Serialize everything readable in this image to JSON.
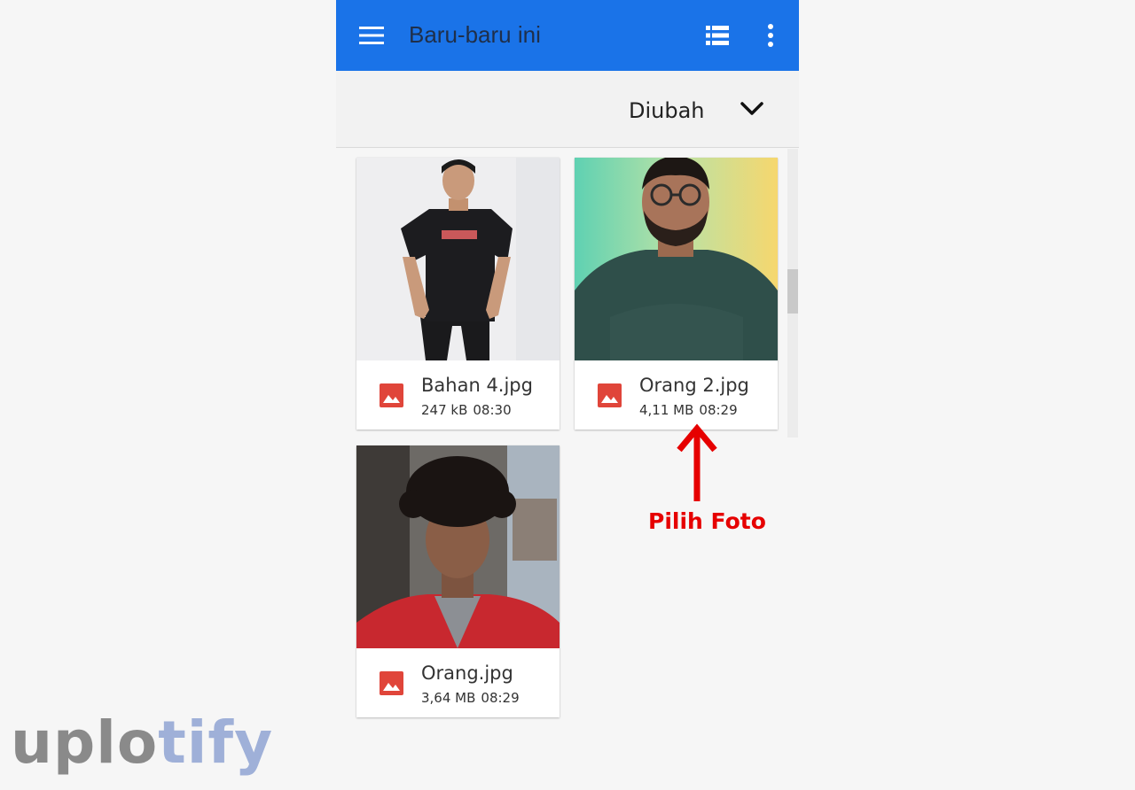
{
  "app_bar": {
    "title": "Baru-baru ini",
    "menu_icon": "hamburger-menu-icon",
    "view_icon": "list-view-icon",
    "more_icon": "more-vert-icon",
    "color": "#1a73e8"
  },
  "sort_bar": {
    "label": "Diubah",
    "icon": "chevron-down-icon"
  },
  "files": [
    {
      "name": "Bahan 4.jpg",
      "size": "247 kB",
      "time": "08:30",
      "icon": "image-file-icon"
    },
    {
      "name": "Orang 2.jpg",
      "size": "4,11 MB",
      "time": "08:29",
      "icon": "image-file-icon"
    },
    {
      "name": "Orang.jpg",
      "size": "3,64 MB",
      "time": "08:29",
      "icon": "image-file-icon"
    }
  ],
  "annotation": {
    "text": "Pilih Foto",
    "color": "#e60000"
  },
  "watermark": {
    "part1": "uplo",
    "part2": "tify"
  }
}
